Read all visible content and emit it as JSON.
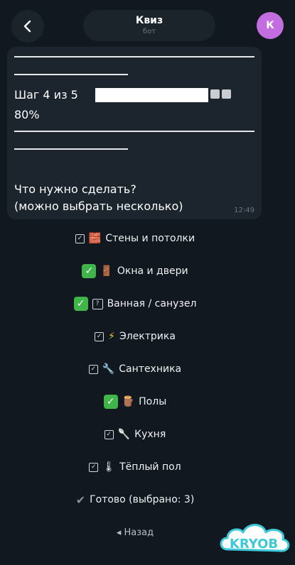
{
  "header": {
    "title": "Квиз",
    "subtitle": "бот",
    "avatar_letter": "К",
    "avatar_color": "#c26de0"
  },
  "message": {
    "step_label": "Шаг 4 из 5",
    "progress_value": 0.8,
    "progress_percent": "80%",
    "question_line1": "Что нужно сделать?",
    "question_line2": "(можно выбрать несколько)",
    "time": "12:49"
  },
  "options": [
    {
      "icon": "bricks-icon",
      "label": "Стены и потолки",
      "selected": false
    },
    {
      "icon": "door-icon",
      "label": "Окна и двери",
      "selected": true
    },
    {
      "icon": "question-box-icon",
      "label": "Ванная / санузел",
      "selected": true
    },
    {
      "icon": "lightning-icon",
      "label": "Электрика",
      "selected": false
    },
    {
      "icon": "wrench-icon",
      "label": "Сантехника",
      "selected": false
    },
    {
      "icon": "wood-icon",
      "label": "Полы",
      "selected": true
    },
    {
      "icon": "spoon-icon",
      "label": "Кухня",
      "selected": false
    },
    {
      "icon": "thermometer-icon",
      "label": "Тёплый пол",
      "selected": false
    }
  ],
  "actions": {
    "done_label": "Готово (выбрано: 3)",
    "back_label": "◂ Назад"
  },
  "brand": {
    "text": "KRYOB",
    "color": "#3cc8d8"
  }
}
